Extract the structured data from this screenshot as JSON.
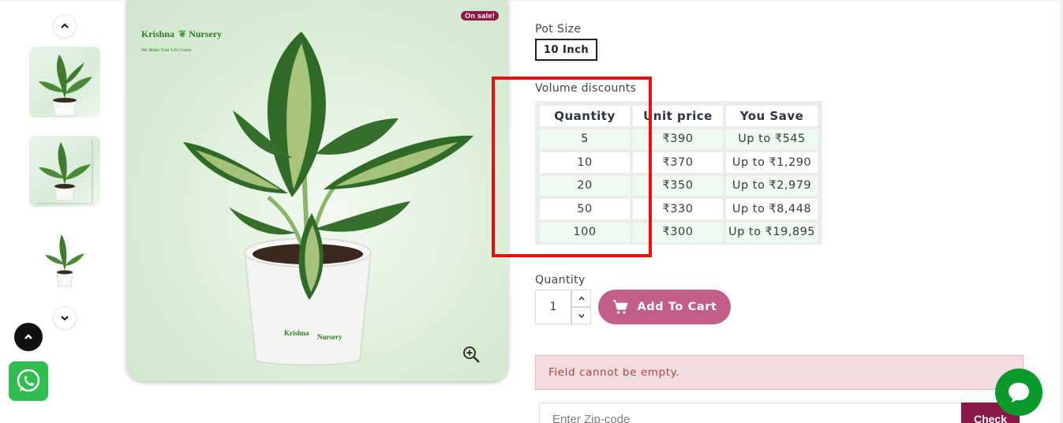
{
  "gallery": {
    "main_image_alt": "Dieffenbachia plant in white pot",
    "sale_badge": "On sale!",
    "logo": {
      "brand_left": "Krishna",
      "brand_right": "Nursery",
      "tagline": "We Make Your Life Green"
    },
    "thumbnails": [
      {
        "alt": "Plant thumbnail 1"
      },
      {
        "alt": "Plant thumbnail 2"
      },
      {
        "alt": "Plant thumbnail 3"
      }
    ]
  },
  "product": {
    "pot_size_label": "Pot Size",
    "pot_size_selected": "10 Inch",
    "volume_discounts_label": "Volume discounts",
    "discounts": {
      "headers": [
        "Quantity",
        "Unit price",
        "You Save"
      ],
      "rows": [
        {
          "qty": "5",
          "price": "₹390",
          "save": "Up to ₹545"
        },
        {
          "qty": "10",
          "price": "₹370",
          "save": "Up to ₹1,290"
        },
        {
          "qty": "20",
          "price": "₹350",
          "save": "Up to ₹2,979"
        },
        {
          "qty": "50",
          "price": "₹330",
          "save": "Up to ₹8,448"
        },
        {
          "qty": "100",
          "price": "₹300",
          "save": "Up to ₹19,895"
        }
      ]
    },
    "quantity_label": "Quantity",
    "quantity_value": "1",
    "add_to_cart_label": "Add To Cart",
    "error_message": "Field cannot be empty.",
    "zip_placeholder": "Enter Zip-code",
    "check_label": "Check"
  },
  "colors": {
    "accent": "#c35e8a",
    "brand": "#8b1846",
    "highlight": "#ef0c0c",
    "whatsapp": "#2ebd4f",
    "chat": "#0a9a2a"
  }
}
